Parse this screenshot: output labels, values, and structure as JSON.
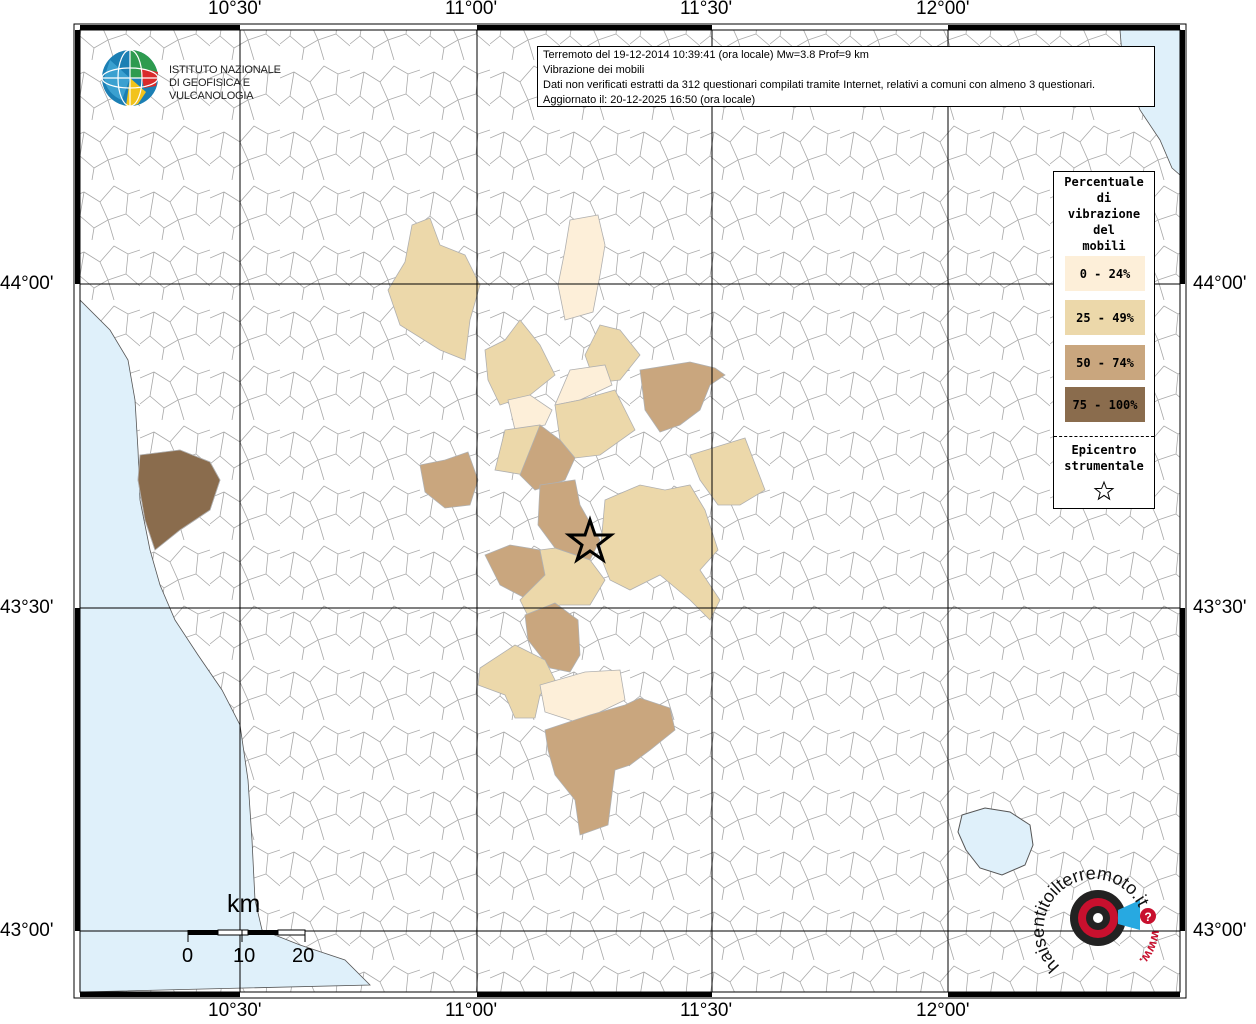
{
  "map": {
    "lon_labels": [
      "10°30'",
      "11°00'",
      "11°30'",
      "12°00'"
    ],
    "lat_labels": [
      "44°00'",
      "43°30'",
      "43°00'"
    ],
    "colors": {
      "sea": "#dff0fa",
      "lake": "#dff0fa",
      "border": "#a0a0a0",
      "grid": "#000000",
      "class_0_24": "#fdefd9",
      "class_25_49": "#ecd8aa",
      "class_50_74": "#c9a67e",
      "class_75_100": "#8a6c4d"
    }
  },
  "info": {
    "line1": "Terremoto del 19-12-2014 10:39:41 (ora locale) Mw=3.8 Prof=9 km",
    "line2": "Vibrazione dei mobili",
    "line3": "Dati non verificati estratti da 312 questionari compilati tramite Internet, relativi a comuni con almeno 3 questionari.",
    "line4": "Aggiornato il: 20-12-2025 16:50 (ora locale)"
  },
  "logo": {
    "line1": "ISTITUTO NAZIONALE",
    "line2": "DI GEOFISICA E VULCANOLOGIA"
  },
  "legend": {
    "title_lines": [
      "Percentuale",
      "di",
      "vibrazione",
      "del",
      "mobili"
    ],
    "classes": [
      {
        "label": "0 - 24%",
        "color": "#fdefd9"
      },
      {
        "label": "25 - 49%",
        "color": "#ecd8aa"
      },
      {
        "label": "50 - 74%",
        "color": "#c9a67e"
      },
      {
        "label": "75 - 100%",
        "color": "#8a6c4d"
      }
    ],
    "epicenter_lines": [
      "Epicentro",
      "strumentale"
    ],
    "epicenter_icon": "star-icon"
  },
  "scale_bar": {
    "unit": "km",
    "ticks": [
      "0",
      "10",
      "20"
    ]
  },
  "watermark": {
    "text_main": "haisentitoilterremoto.it",
    "text_small": "www.",
    "question": "?"
  }
}
